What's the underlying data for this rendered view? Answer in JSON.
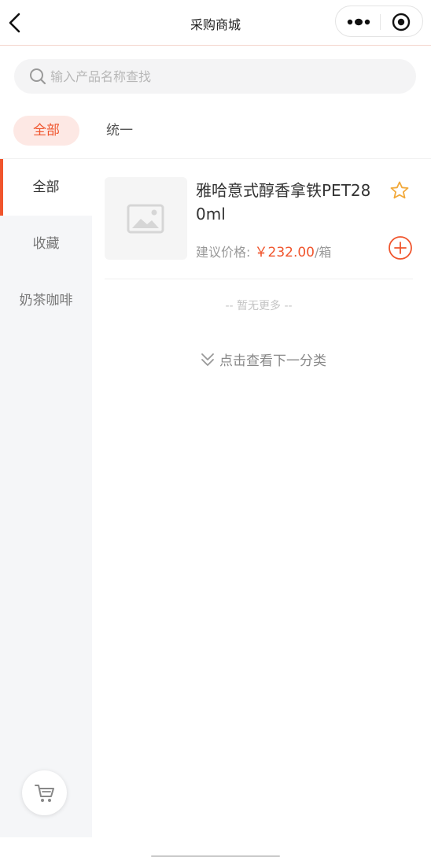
{
  "navbar": {
    "title": "采购商城",
    "back_icon": "chevron-left-icon",
    "more_icon": "more-dots-icon",
    "close_icon": "target-circle-icon"
  },
  "search": {
    "placeholder": "输入产品名称查找",
    "value": "",
    "icon": "search-icon"
  },
  "brand_tabs": [
    {
      "label": "全部",
      "active": true
    },
    {
      "label": "统一",
      "active": false
    }
  ],
  "sidebar": {
    "items": [
      {
        "label": "全部",
        "active": true
      },
      {
        "label": "收藏",
        "active": false
      },
      {
        "label": "奶茶咖啡",
        "active": false
      }
    ]
  },
  "products": [
    {
      "name": "雅哈意式醇香拿铁PET280ml",
      "price_label": "建议价格:",
      "price": "￥232.00",
      "unit": "/箱",
      "thumb_icon": "image-placeholder-icon",
      "favorite_icon": "star-outline-icon",
      "add_icon": "plus-circle-icon"
    }
  ],
  "list_footer": {
    "no_more": "-- 暂无更多 --",
    "next_category": "点击查看下一分类",
    "next_icon": "double-chevron-down-icon"
  },
  "cart": {
    "icon": "cart-icon"
  },
  "colors": {
    "accent": "#f0552d",
    "accent_soft": "#fde8e4",
    "star": "#f2a93b",
    "sidebar_bg": "#f5f6f8"
  }
}
